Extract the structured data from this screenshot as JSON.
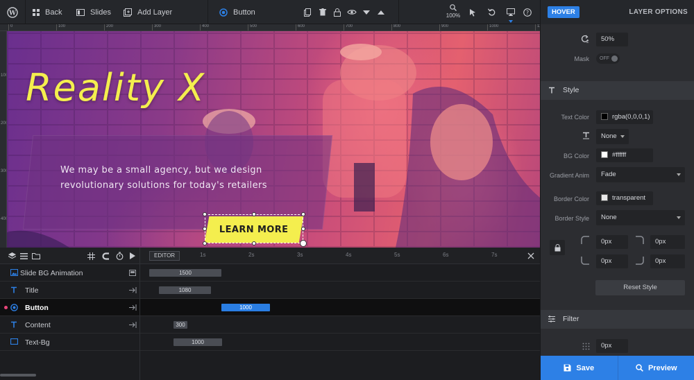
{
  "toolbar": {
    "back": "Back",
    "slides": "Slides",
    "add_layer": "Add Layer",
    "layer_name": "Button",
    "zoom": "100%"
  },
  "ruler": {
    "top_ticks": [
      "0",
      "100",
      "200",
      "300",
      "400",
      "500",
      "600",
      "700",
      "800",
      "900",
      "1000",
      "1100"
    ],
    "left_ticks": [
      "0",
      "100",
      "200",
      "300",
      "400",
      "500"
    ]
  },
  "canvas": {
    "title": "Reality X",
    "content_line1": "We may be a small agency, but we design",
    "content_line2": "revolutionary solutions for today's retailers",
    "button_text": "LEARN MORE"
  },
  "timeline": {
    "editor_label": "EDITOR",
    "ticks": [
      "1s",
      "2s",
      "3s",
      "4s",
      "5s",
      "6s",
      "7s"
    ],
    "rows": [
      {
        "name": "Slide BG Animation",
        "bar": "1500"
      },
      {
        "name": "Title",
        "bar": "1080"
      },
      {
        "name": "Button",
        "bar": "1000"
      },
      {
        "name": "Content",
        "bar": "300"
      },
      {
        "name": "Text-Bg",
        "bar": "1000"
      }
    ]
  },
  "panel": {
    "hover": "HOVER",
    "layer_options": "LAYER OPTIONS",
    "rotate_z": "50%",
    "mask_label": "Mask",
    "mask_value": "OFF",
    "style_section": "Style",
    "text_color_label": "Text Color",
    "text_color_value": "rgba(0,0,0,1)",
    "text_decoration_value": "None",
    "bg_color_label": "BG Color",
    "bg_color_value": "#ffffff",
    "gradient_anim_label": "Gradient Anim",
    "gradient_anim_value": "Fade",
    "border_color_label": "Border Color",
    "border_color_value": "transparent",
    "border_style_label": "Border Style",
    "border_style_value": "None",
    "radius_tl": "0px",
    "radius_tr": "0px",
    "radius_bl": "0px",
    "radius_br": "0px",
    "reset_style": "Reset Style",
    "filter_section": "Filter",
    "filter_value": "0px",
    "save": "Save",
    "preview": "Preview"
  },
  "colors": {
    "accent": "#2d80e6",
    "title_yellow": "#f4ee4e"
  }
}
